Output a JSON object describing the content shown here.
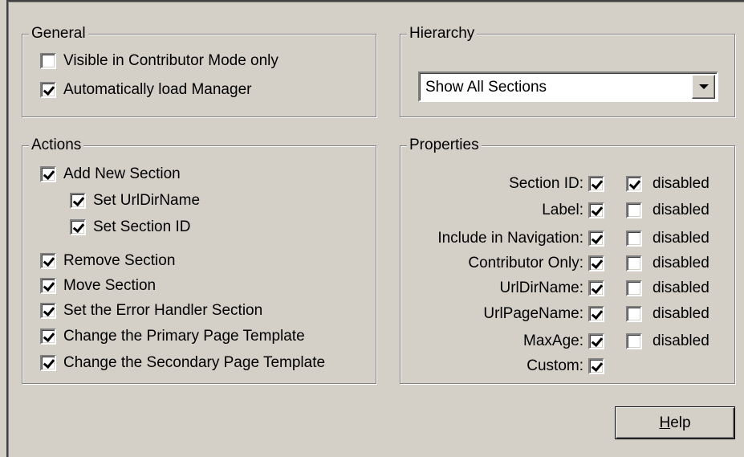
{
  "general": {
    "legend": "General",
    "visible_contributor": {
      "label": "Visible in Contributor Mode only",
      "checked": false
    },
    "auto_load_manager": {
      "label": "Automatically load Manager",
      "checked": true
    }
  },
  "hierarchy": {
    "legend": "Hierarchy",
    "selected": "Show All Sections"
  },
  "actions": {
    "legend": "Actions",
    "items": [
      {
        "label": "Add New Section",
        "checked": true
      },
      {
        "label": "Set UrlDirName",
        "checked": true
      },
      {
        "label": "Set Section ID",
        "checked": true
      },
      {
        "label": "Remove Section",
        "checked": true
      },
      {
        "label": "Move Section",
        "checked": true
      },
      {
        "label": "Set the Error Handler Section",
        "checked": true
      },
      {
        "label": "Change the Primary Page Template",
        "checked": true
      },
      {
        "label": "Change the Secondary Page Template",
        "checked": true
      }
    ]
  },
  "properties": {
    "legend": "Properties",
    "disabled_label": "disabled",
    "rows": [
      {
        "label": "Section ID:",
        "checked": true,
        "disabled": true
      },
      {
        "label": "Label:",
        "checked": true,
        "disabled": false
      },
      {
        "label": "Include in Navigation:",
        "checked": true,
        "disabled": false
      },
      {
        "label": "Contributor Only:",
        "checked": true,
        "disabled": false
      },
      {
        "label": "UrlDirName:",
        "checked": true,
        "disabled": false
      },
      {
        "label": "UrlPageName:",
        "checked": true,
        "disabled": false
      },
      {
        "label": "MaxAge:",
        "checked": true,
        "disabled": false
      },
      {
        "label": "Custom:",
        "checked": true
      }
    ]
  },
  "help_button": {
    "mnemonic": "H",
    "rest": "elp"
  }
}
